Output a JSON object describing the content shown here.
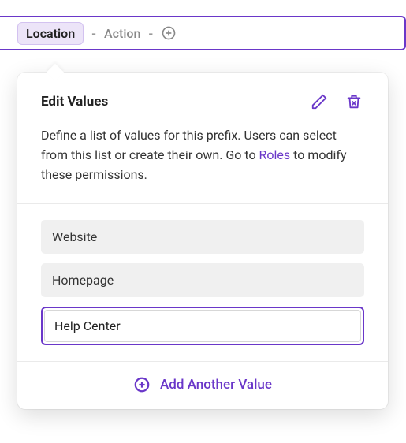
{
  "breadcrumb": {
    "location_label": "Location",
    "sep": "-",
    "action_label": "Action"
  },
  "popover": {
    "title": "Edit Values",
    "desc_before": "Define a list of values for this prefix. Users can select from this list or create their own. Go to ",
    "roles_link": "Roles",
    "desc_after": " to modify these permissions.",
    "values": {
      "0": "Website",
      "1": "Homepage",
      "2": "Help Center"
    },
    "add_label": "Add Another Value"
  },
  "icons": {
    "edit": "edit-icon",
    "trash": "trash-icon",
    "plus": "plus-circle-icon"
  },
  "colors": {
    "accent": "#6a37c9",
    "pill_bg": "#ece4f8"
  }
}
